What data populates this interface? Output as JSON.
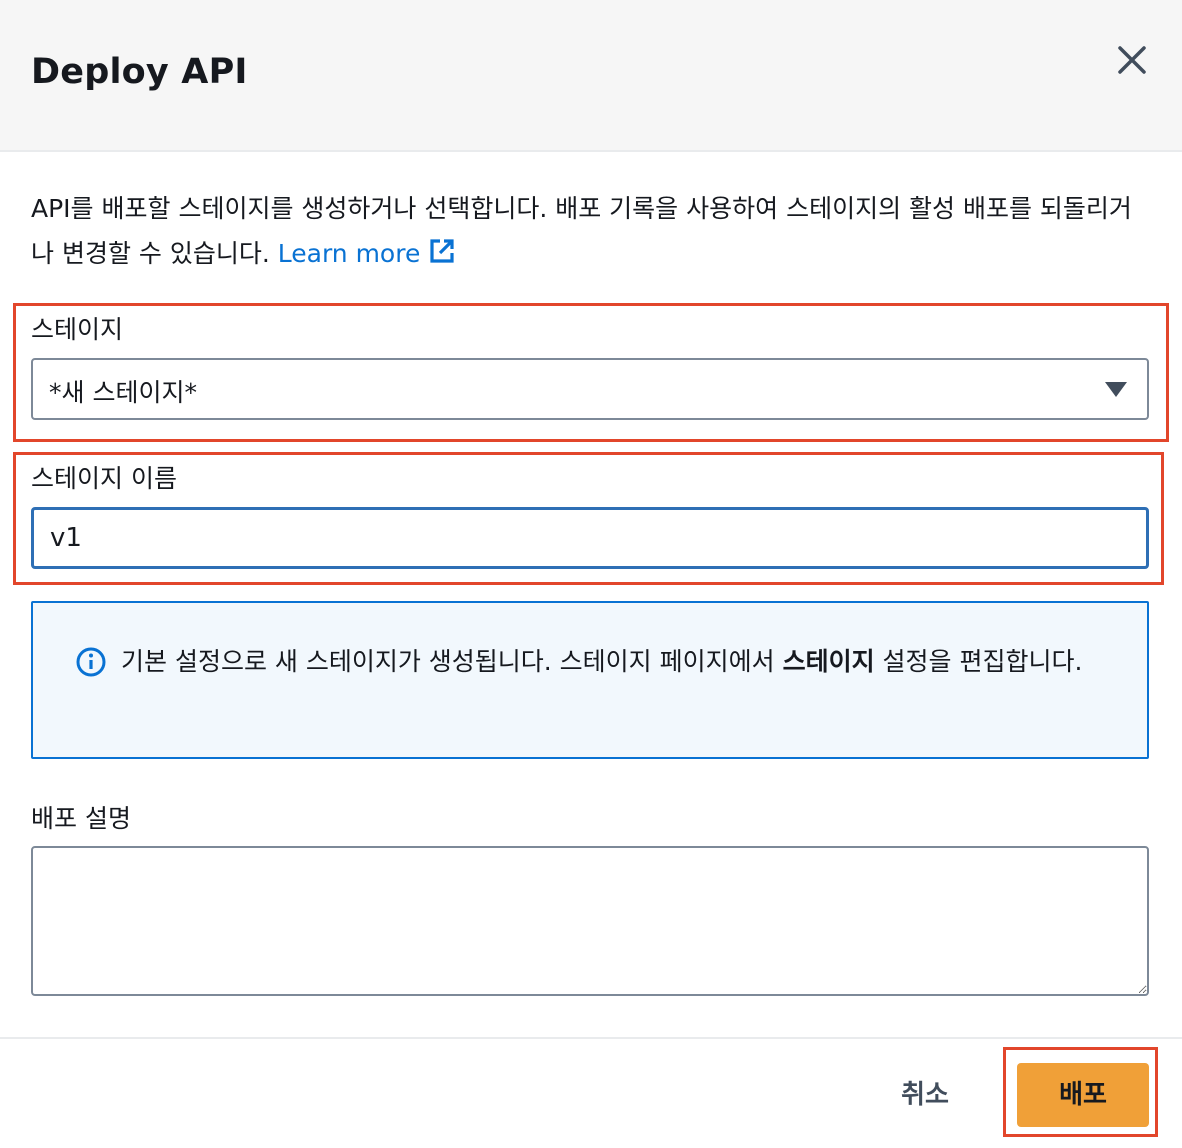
{
  "dialog": {
    "title": "Deploy API",
    "close_icon": "close-icon"
  },
  "description": {
    "text": "API를 배포할 스테이지를 생성하거나 선택합니다. 배포 기록을 사용하여 스테이지의 활성 배포를 되돌리거나 변경할 수 있습니다.",
    "link_label": "Learn more",
    "link_icon": "external-link-icon"
  },
  "stage": {
    "label": "스테이지",
    "selected_value": "*새 스테이지*"
  },
  "stage_name": {
    "label": "스테이지 이름",
    "value": "v1"
  },
  "info_alert": {
    "icon": "info-icon",
    "text_before": "기본 설정으로 새 스테이지가 생성됩니다. 스테이지 페이지에서 ",
    "text_bold": "스테이지",
    "text_after": " 설정을 편집합니다."
  },
  "deployment_description": {
    "label": "배포 설명",
    "value": ""
  },
  "footer": {
    "cancel_label": "취소",
    "deploy_label": "배포"
  },
  "colors": {
    "primary_button": "#f0a038",
    "link": "#0972d3",
    "highlight": "#e2462b",
    "info_background": "#f2f8fd"
  }
}
